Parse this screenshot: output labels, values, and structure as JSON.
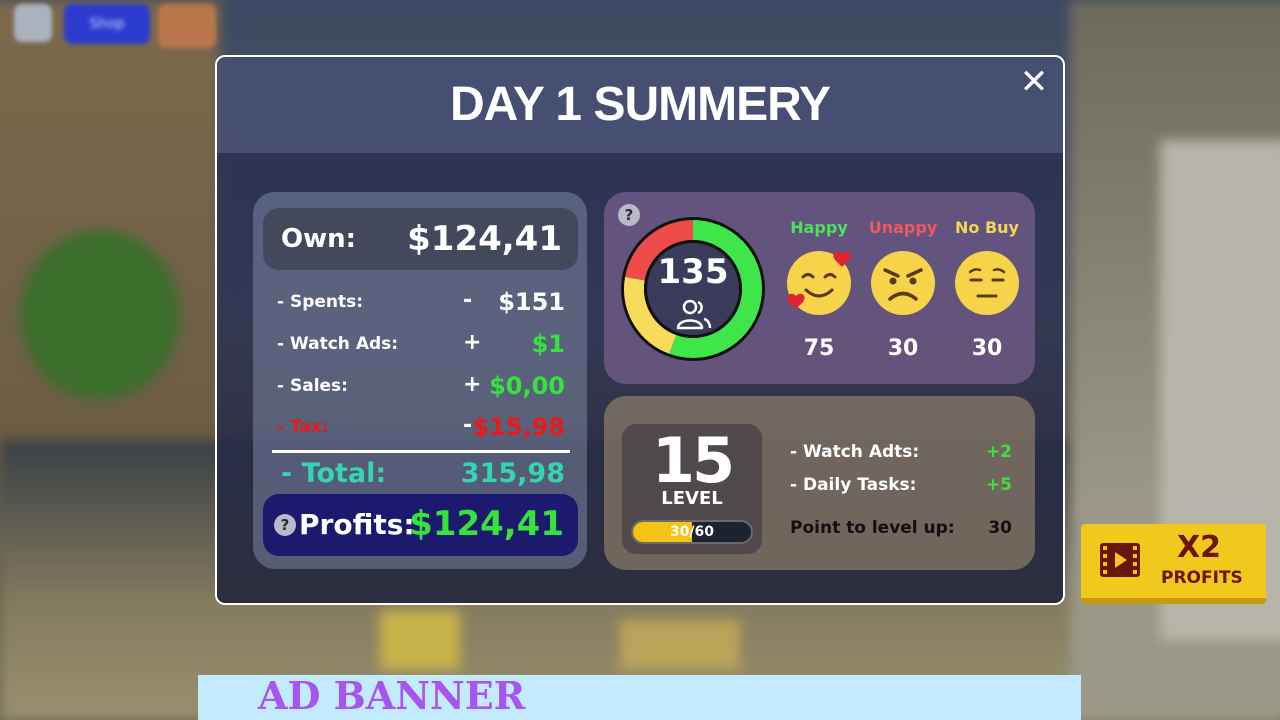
{
  "hud": {
    "shop_label": "Shop"
  },
  "modal": {
    "title": "DAY 1 SUMMERY",
    "close_glyph": "✕"
  },
  "finance": {
    "own_label": "Own:",
    "own_value": "$124,41",
    "lines": [
      {
        "label": "- Spents:",
        "sign": "-",
        "value": "$151",
        "label_color": "#ffffff",
        "value_color": "#ffffff"
      },
      {
        "label": "- Watch Ads:",
        "sign": "+",
        "value": "$1",
        "label_color": "#ffffff",
        "value_color": "#36e33c"
      },
      {
        "label": "- Sales:",
        "sign": "+",
        "value": "$0,00",
        "label_color": "#ffffff",
        "value_color": "#36e33c"
      },
      {
        "label": "- Tax:",
        "sign": "-",
        "value": "$15,98",
        "label_color": "#e81a1a",
        "value_color": "#e81a1a"
      }
    ],
    "total_label": "- Total:",
    "total_value": "315,98",
    "profits_label": "Profits:",
    "profits_value": "$124,41",
    "help_glyph": "?"
  },
  "customers": {
    "help_glyph": "?",
    "total": "135",
    "ring": {
      "happy_color": "#3ee64a",
      "unhappy_color": "#ee4b4b",
      "nobuy_color": "#f7dc5b",
      "values": {
        "happy": 75,
        "unhappy": 30,
        "nobuy": 30
      }
    },
    "groups": [
      {
        "label": "Happy",
        "color": "#4ee25a",
        "value": "75",
        "face": "happy-face-icon"
      },
      {
        "label": "Unappy",
        "color": "#ef5a5a",
        "value": "30",
        "face": "angry-face-icon"
      },
      {
        "label": "No Buy",
        "color": "#f5d45a",
        "value": "30",
        "face": "neutral-face-icon"
      }
    ]
  },
  "level": {
    "number": "15",
    "word": "LEVEL",
    "xp_text": "30/60",
    "xp_progress": 0.5,
    "rows": [
      {
        "label": "- Watch Adts:",
        "value": "+2"
      },
      {
        "label": "- Daily Tasks:",
        "value": "+5"
      }
    ],
    "level_up_label": "Point to level up:",
    "level_up_value": "30"
  },
  "x2_button": {
    "big": "X2",
    "small": "PROFITS"
  },
  "ad_banner": {
    "text": "AD BANNER"
  }
}
